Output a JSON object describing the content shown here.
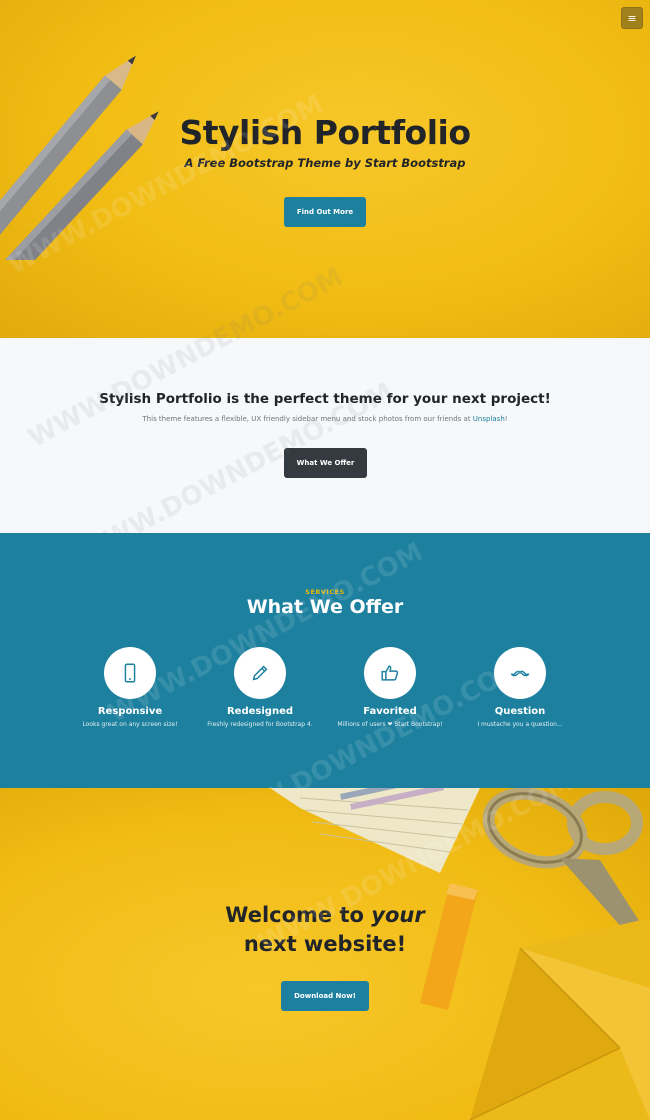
{
  "hero": {
    "title": "Stylish Portfolio",
    "subtitle": "A Free Bootstrap Theme by Start Bootstrap",
    "button_label": "Find Out More",
    "menu_icon": "hamburger-icon",
    "menu_glyph": "≡"
  },
  "about": {
    "title": "Stylish Portfolio is the perfect theme for your next project!",
    "text_before_link": "This theme features a flexible, UX friendly sidebar menu and stock photos from our friends at ",
    "link_text": "Unsplash",
    "text_after_link": "!",
    "button_label": "What We Offer"
  },
  "services": {
    "kicker": "SERVICES",
    "title": "What We Offer",
    "items": [
      {
        "icon": "mobile-phone-icon",
        "name": "Responsive",
        "desc": "Looks great on any screen size!"
      },
      {
        "icon": "pencil-icon",
        "name": "Redesigned",
        "desc": "Freshly redesigned for Bootstrap 4."
      },
      {
        "icon": "thumbs-up-icon",
        "name": "Favorited",
        "desc": "Millions of users ❤ Start Bootstrap!"
      },
      {
        "icon": "mustache-icon",
        "name": "Question",
        "desc": "I mustache you a question..."
      }
    ]
  },
  "callout": {
    "title_prefix": "Welcome to ",
    "title_emphasis": "your",
    "title_line2": "next website!",
    "button_label": "Download Now!"
  },
  "watermark": "WWW.DOWNDEMO.COM",
  "colors": {
    "primary": "#1d809f",
    "accent_yellow": "#ecb807",
    "dark": "#343a40",
    "text": "#212529"
  }
}
